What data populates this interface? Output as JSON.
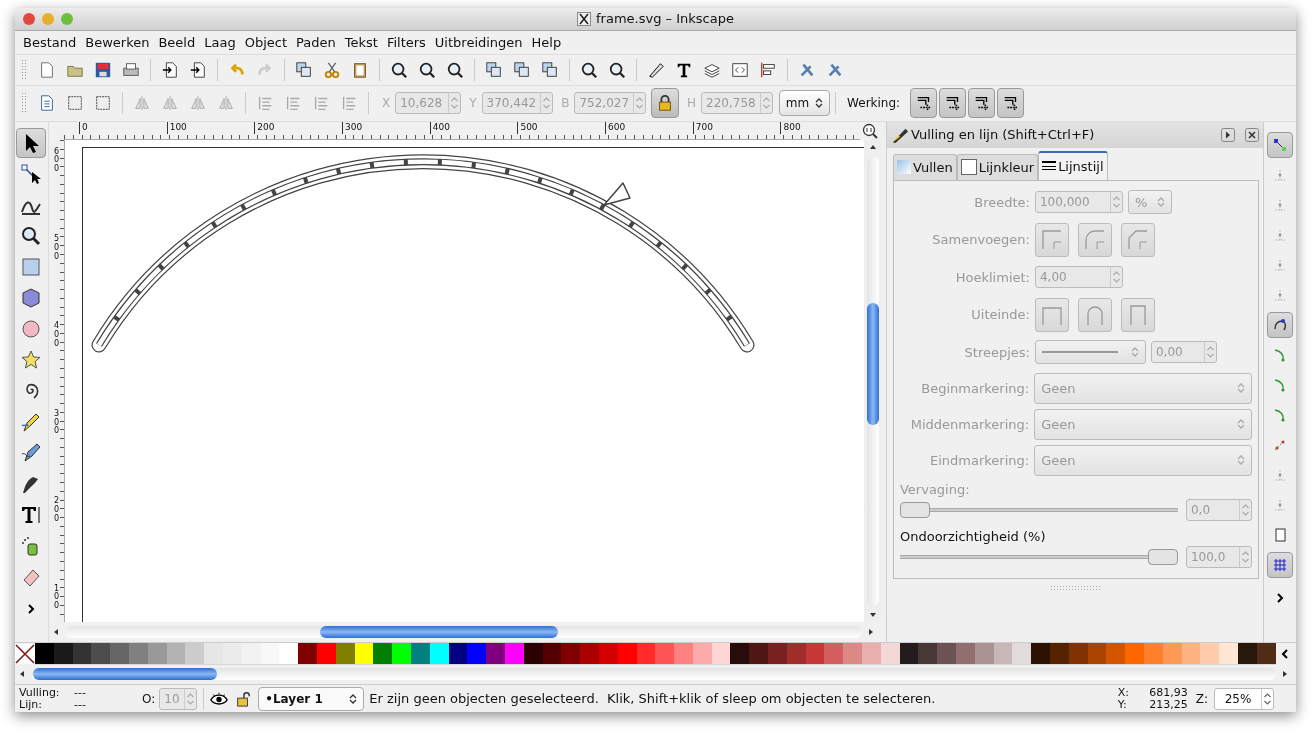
{
  "window": {
    "title": "frame.svg – Inkscape"
  },
  "menu": [
    "Bestand",
    "Bewerken",
    "Beeld",
    "Laag",
    "Object",
    "Paden",
    "Tekst",
    "Filters",
    "Uitbreidingen",
    "Help"
  ],
  "selection_bar": {
    "fields": [
      {
        "label": "X",
        "value": "10,628"
      },
      {
        "label": "Y",
        "value": "370,442"
      },
      {
        "label": "B",
        "value": "752,027"
      },
      {
        "label": "H",
        "value": "220,758"
      }
    ],
    "unit": "mm",
    "mode_label": "Werking:"
  },
  "rulers": {
    "horizontal": [
      "0",
      "100",
      "200",
      "300",
      "400",
      "500",
      "600",
      "700",
      "800"
    ],
    "vertical": [
      "600",
      "500",
      "400",
      "300",
      "200",
      "100"
    ]
  },
  "tools": [
    {
      "selected": true
    },
    {
      "selected": false
    },
    {
      "selected": false
    },
    {
      "selected": false
    },
    {
      "selected": false
    },
    {
      "selected": false
    },
    {
      "selected": false
    },
    {
      "selected": false
    },
    {
      "selected": false
    },
    {
      "selected": false
    },
    {
      "selected": false
    },
    {
      "selected": false
    },
    {
      "selected": false
    },
    {
      "selected": false
    },
    {
      "selected": false
    }
  ],
  "dialog": {
    "title": "Vulling en lijn (Shift+Ctrl+F)",
    "tabs": [
      {
        "label": "Vullen",
        "selected": false
      },
      {
        "label": "Lijnkleur",
        "selected": false
      },
      {
        "label": "Lijnstijl",
        "selected": true
      }
    ],
    "rows": [
      {
        "kind": "spin",
        "label": "Breedte:",
        "value": "100,000",
        "unit": "%"
      },
      {
        "kind": "buttons",
        "label": "Samenvoegen:"
      },
      {
        "kind": "spin",
        "label": "Hoeklimiet:",
        "value": "4,00"
      },
      {
        "kind": "caps",
        "label": "Uiteinde:"
      },
      {
        "kind": "dash",
        "label": "Streepjes:",
        "value": "0,00"
      },
      {
        "kind": "select",
        "label": "Beginmarkering:",
        "value": "Geen"
      },
      {
        "kind": "select",
        "label": "Middenmarkering:",
        "value": "Geen"
      },
      {
        "kind": "select",
        "label": "Eindmarkering:",
        "value": "Geen"
      }
    ],
    "sliders": [
      {
        "label": "Vervaging:",
        "disabled": true,
        "level": 0,
        "value": "0,0"
      },
      {
        "label": "Ondoorzichtigheid (%)",
        "disabled": false,
        "level": 1,
        "value": "100,0"
      }
    ]
  },
  "snap_controls": [
    {
      "on": true
    },
    {
      "on": false
    },
    {
      "on": false
    },
    {
      "on": false
    },
    {
      "on": false
    },
    {
      "on": false
    },
    {
      "on": true
    },
    {
      "on": false
    },
    {
      "on": false
    },
    {
      "on": false
    },
    {
      "on": false
    },
    {
      "on": false
    },
    {
      "on": false
    },
    {
      "on": false
    },
    {
      "on": true
    }
  ],
  "palette": [
    {
      "color": "#000000"
    },
    {
      "color": "#1a1a1a"
    },
    {
      "color": "#333333"
    },
    {
      "color": "#4d4d4d"
    },
    {
      "color": "#666666"
    },
    {
      "color": "#808080"
    },
    {
      "color": "#999999"
    },
    {
      "color": "#b3b3b3"
    },
    {
      "color": "#cccccc"
    },
    {
      "color": "#e6e6e6"
    },
    {
      "color": "#ececec"
    },
    {
      "color": "#f2f2f2"
    },
    {
      "color": "#f8f8f8"
    },
    {
      "color": "#ffffff"
    },
    {
      "color": "#800000"
    },
    {
      "color": "#ff0000"
    },
    {
      "color": "#808000"
    },
    {
      "color": "#ffff00"
    },
    {
      "color": "#008000"
    },
    {
      "color": "#00ff00"
    },
    {
      "color": "#008080"
    },
    {
      "color": "#00ffff"
    },
    {
      "color": "#000080"
    },
    {
      "color": "#0000ff"
    },
    {
      "color": "#800080"
    },
    {
      "color": "#ff00ff"
    },
    {
      "color": "#2b0000"
    },
    {
      "color": "#550000"
    },
    {
      "color": "#800000"
    },
    {
      "color": "#aa0000"
    },
    {
      "color": "#d40000"
    },
    {
      "color": "#ff0000"
    },
    {
      "color": "#ff2a2a"
    },
    {
      "color": "#ff5555"
    },
    {
      "color": "#ff8080"
    },
    {
      "color": "#ffaaaa"
    },
    {
      "color": "#ffd5d5"
    },
    {
      "color": "#280b0b"
    },
    {
      "color": "#501616"
    },
    {
      "color": "#782121"
    },
    {
      "color": "#a02c2c"
    },
    {
      "color": "#c83737"
    },
    {
      "color": "#d35f5f"
    },
    {
      "color": "#de8787"
    },
    {
      "color": "#e9afaf"
    },
    {
      "color": "#f4d7d7"
    },
    {
      "color": "#241c1c"
    },
    {
      "color": "#483737"
    },
    {
      "color": "#6c5353"
    },
    {
      "color": "#916f6f"
    },
    {
      "color": "#ac9393"
    },
    {
      "color": "#c8b7b7"
    },
    {
      "color": "#e3dbdb"
    },
    {
      "color": "#2b1100"
    },
    {
      "color": "#552200"
    },
    {
      "color": "#803300"
    },
    {
      "color": "#aa4400"
    },
    {
      "color": "#d45500"
    },
    {
      "color": "#ff6600"
    },
    {
      "color": "#ff7f2a"
    },
    {
      "color": "#ff9955"
    },
    {
      "color": "#ffb380"
    },
    {
      "color": "#ffccaa"
    },
    {
      "color": "#ffe6d5"
    },
    {
      "color": "#28170b"
    },
    {
      "color": "#502d16"
    }
  ],
  "status": {
    "fill_label": "Vulling:",
    "fill_value": "---",
    "stroke_label": "Lijn:",
    "stroke_value": "---",
    "opacity_label": "O:",
    "opacity_value": "10",
    "layer": "•Layer 1",
    "message": "Er zijn geen objecten geselecteerd.  Klik, Shift+klik of sleep om objecten te selecteren.",
    "x_label": "X:",
    "x_value": "681,93",
    "y_label": "Y:",
    "y_value": "213,25",
    "zoom_label": "Z:",
    "zoom_value": "25%"
  }
}
